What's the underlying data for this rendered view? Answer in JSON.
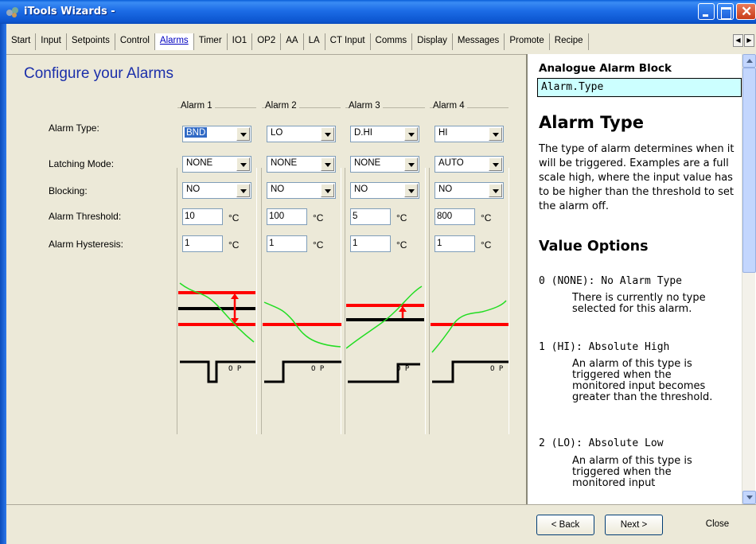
{
  "window": {
    "title": "iTools Wizards -"
  },
  "tabs": [
    {
      "label": "Start"
    },
    {
      "label": "Input"
    },
    {
      "label": "Setpoints"
    },
    {
      "label": "Control"
    },
    {
      "label": "Alarms",
      "active": true
    },
    {
      "label": "Timer"
    },
    {
      "label": "IO1"
    },
    {
      "label": "OP2"
    },
    {
      "label": "AA"
    },
    {
      "label": "LA"
    },
    {
      "label": "CT Input"
    },
    {
      "label": "Comms"
    },
    {
      "label": "Display"
    },
    {
      "label": "Messages"
    },
    {
      "label": "Promote"
    },
    {
      "label": "Recipe"
    }
  ],
  "main": {
    "title": "Configure your Alarms",
    "row_labels": {
      "type": "Alarm Type:",
      "latching": "Latching Mode:",
      "blocking": "Blocking:",
      "threshold": "Alarm Threshold:",
      "hysteresis": "Alarm Hysteresis:"
    },
    "unit": "°C",
    "op_label": "O P",
    "alarms": [
      {
        "header": "Alarm 1",
        "type": "BND",
        "latching": "NONE",
        "blocking": "NO",
        "threshold": "10",
        "hysteresis": "1"
      },
      {
        "header": "Alarm 2",
        "type": "LO",
        "latching": "NONE",
        "blocking": "NO",
        "threshold": "100",
        "hysteresis": "1"
      },
      {
        "header": "Alarm 3",
        "type": "D.HI",
        "latching": "NONE",
        "blocking": "NO",
        "threshold": "5",
        "hysteresis": "1"
      },
      {
        "header": "Alarm 4",
        "type": "HI",
        "latching": "AUTO",
        "blocking": "NO",
        "threshold": "800",
        "hysteresis": "1"
      }
    ]
  },
  "help": {
    "block_name": "Analogue Alarm Block",
    "param": "Alarm.Type",
    "heading": "Alarm Type",
    "description": "The type of alarm determines when it will be triggered. Examples are a full scale high, where the input value has to be higher than the threshold to set the alarm off.",
    "options_heading": "Value Options",
    "options": [
      {
        "label": "0 (NONE): No Alarm Type",
        "desc": "There is currently no type selected for this alarm."
      },
      {
        "label": "1 (HI): Absolute High",
        "desc": "An alarm of this type is triggered when the monitored input becomes greater than the threshold."
      },
      {
        "label": "2 (LO): Absolute Low",
        "desc": "An alarm of this type is triggered when the monitored input"
      }
    ]
  },
  "footer": {
    "back": "< Back",
    "next": "Next >",
    "close": "Close"
  },
  "colors": {
    "title_blue": "#1b2faa",
    "help_param_bg": "#ccffff",
    "graph_red": "#ff0000",
    "graph_green": "#00dd00"
  }
}
